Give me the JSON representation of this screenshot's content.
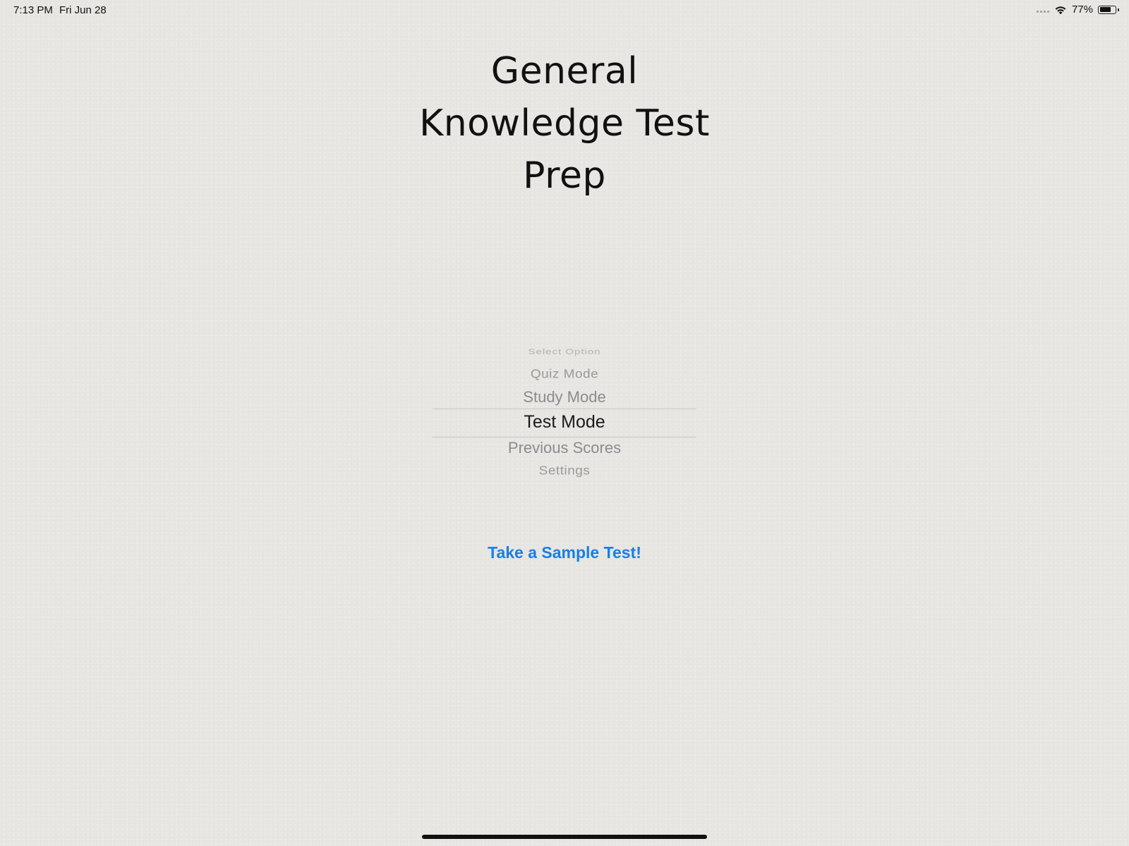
{
  "status_bar": {
    "time": "7:13 PM",
    "date": "Fri Jun 28",
    "battery_percent_label": "77%",
    "battery_level": 0.77
  },
  "title": {
    "lines": [
      "General",
      "Knowledge Test",
      "Prep"
    ]
  },
  "picker": {
    "items": [
      "Select Option",
      "Quiz Mode",
      "Study Mode",
      "Test Mode",
      "Previous Scores",
      "Settings"
    ],
    "selected": "Test Mode"
  },
  "sample_test": {
    "label": "Take a Sample Test!"
  },
  "colors": {
    "link": "#1a7ee6",
    "background": "#e7e6e3"
  }
}
